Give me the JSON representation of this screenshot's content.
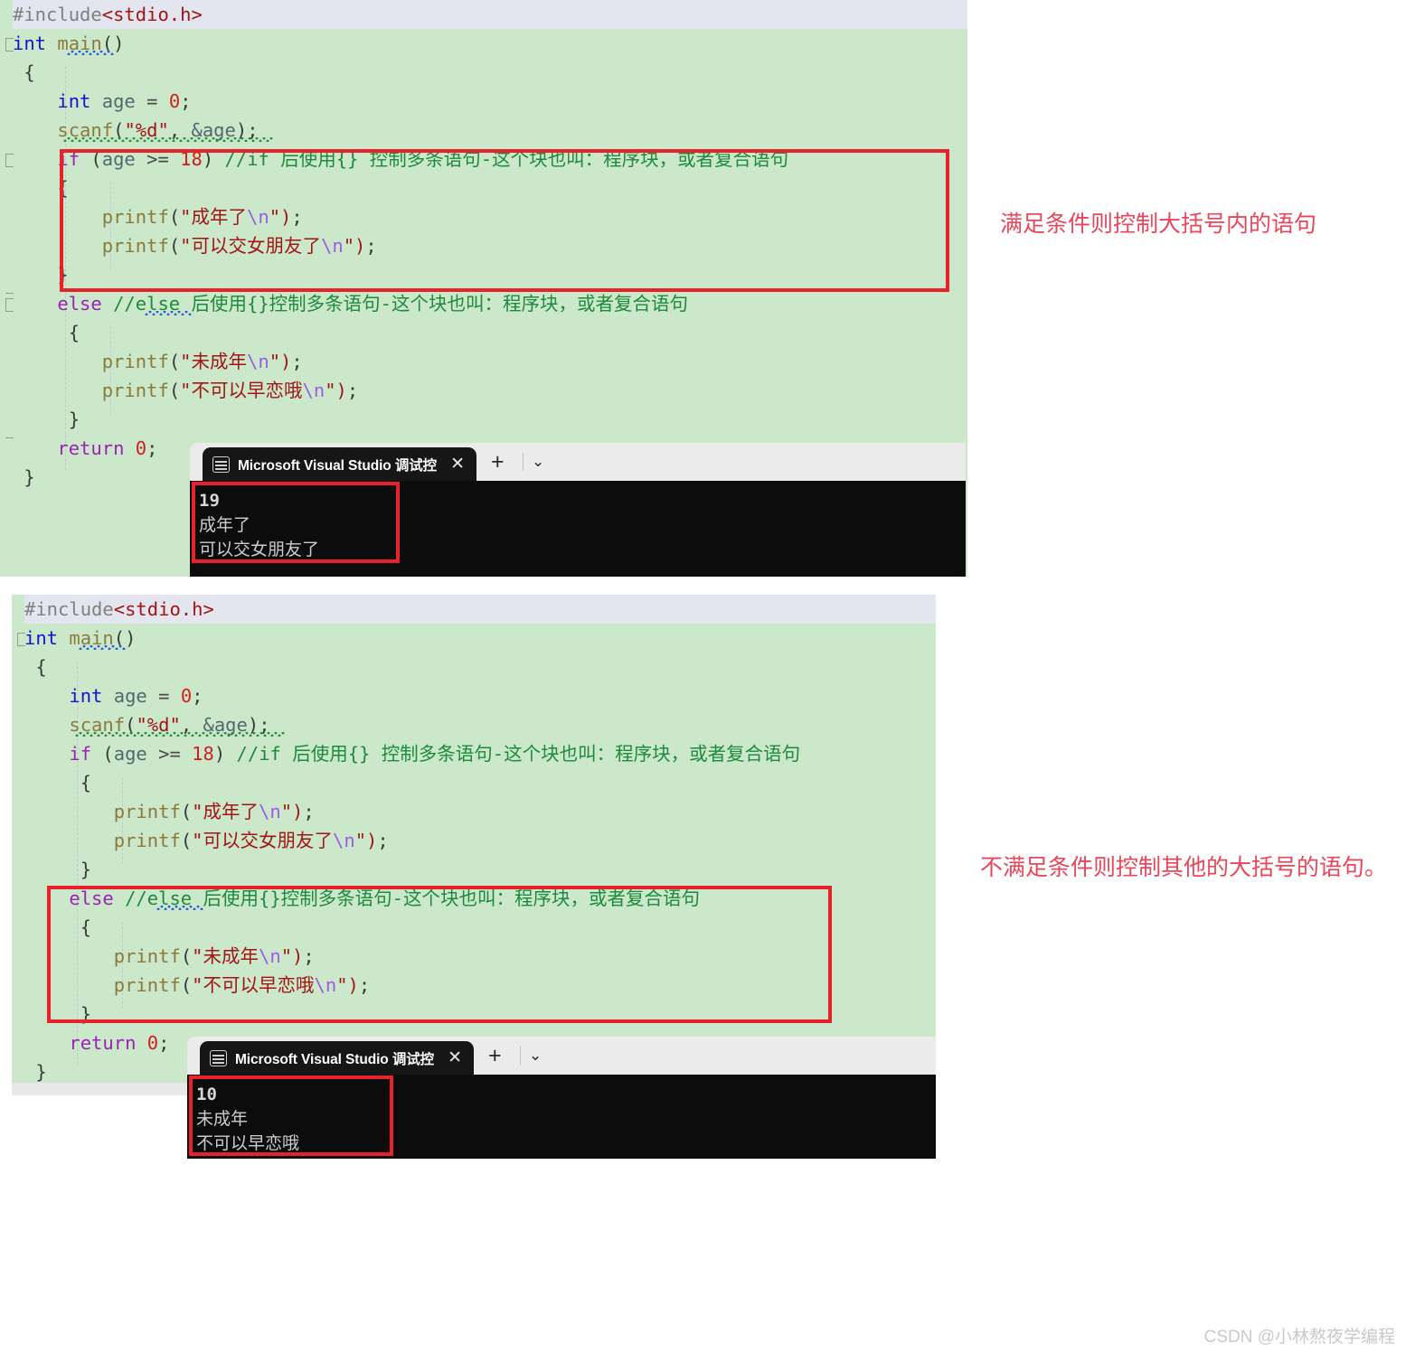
{
  "watermark": "CSDN @小林熬夜学编程",
  "notes": {
    "top": "满足条件则控制大括号内的语句",
    "bottom": "不满足条件则控制其他的大括号的语句。"
  },
  "tokens": {
    "include_pre": "#include",
    "include_hdr": "<stdio.h>",
    "kw_int": "int",
    "fn_main": "main",
    "paren_empty": "()",
    "brace_open": "{",
    "brace_close": "}",
    "id_age": "age",
    "eq": "=",
    "num_zero": "0",
    "semi": ";",
    "fn_scanf": "scanf",
    "str_pct_d": "\"%d\"",
    "amp_age": "&age",
    "ctl_if": "if",
    "ctl_else": "else",
    "ctl_return": "return",
    "op_ge": ">=",
    "num_18": "18",
    "fn_printf": "printf",
    "esc_n": "\\n",
    "str_adult": "\"成年了",
    "str_girlfriend": "\"可以交女朋友了",
    "str_minor": "\"未成年",
    "str_noluv": "\"不可以早恋哦",
    "quote_close": "\")",
    "cmt_if": "//if 后使用{} 控制多条语句-这个块也叫：程序块，或者复合语句",
    "cmt_else": "//else 后使用{}控制多条语句-这个块也叫：程序块，或者复合语句"
  },
  "editor1": {
    "name": "code-editor-if-branch-highlighted",
    "lines": [
      "#include<stdio.h>",
      "int main()",
      "{",
      "    int age = 0;",
      "    scanf(\"%d\", &age);",
      "    if (age >= 18) //if 后使用{} 控制多条语句-这个块也叫：程序块，或者复合语句",
      "    {",
      "        printf(\"成年了\\n\");",
      "        printf(\"可以交女朋友了\\n\");",
      "    }",
      "    else //else 后使用{}控制多条语句-这个块也叫：程序块，或者复合语句",
      "    {",
      "        printf(\"未成年\\n\");",
      "        printf(\"不可以早恋哦\\n\");",
      "    }",
      "    return 0;",
      "}"
    ]
  },
  "editor2": {
    "name": "code-editor-else-branch-highlighted",
    "lines": [
      "#include<stdio.h>",
      "int main()",
      "{",
      "    int age = 0;",
      "    scanf(\"%d\", &age);",
      "    if (age >= 18) //if 后使用{} 控制多条语句-这个块也叫：程序块，或者复合语句",
      "    {",
      "        printf(\"成年了\\n\");",
      "        printf(\"可以交女朋友了\\n\");",
      "    }",
      "    else //else 后使用{}控制多条语句-这个块也叫：程序块，或者复合语句",
      "    {",
      "        printf(\"未成年\\n\");",
      "        printf(\"不可以早恋哦\\n\");",
      "    }",
      "    return 0;",
      "}"
    ]
  },
  "terminal1": {
    "tab_title": "Microsoft Visual Studio 调试控",
    "close_label": "✕",
    "new_tab_label": "+",
    "dropdown_label": "⌄",
    "output": [
      "19",
      "成年了",
      "可以交女朋友了"
    ]
  },
  "terminal2": {
    "tab_title": "Microsoft Visual Studio 调试控",
    "close_label": "✕",
    "new_tab_label": "+",
    "dropdown_label": "⌄",
    "output": [
      "10",
      "未成年",
      "不可以早恋哦"
    ]
  },
  "colors": {
    "editor_bg": "#cbe8ca",
    "highlight_line": "#e4e6ef",
    "redbox": "#e8222a",
    "note_red": "#e8465a",
    "terminal_bg": "#0c0c0c",
    "tabbar_bg": "#ebebeb",
    "keyword_blue": "#1414cf",
    "control_purple": "#9b22b5",
    "string_red": "#a31515",
    "comment_green": "#1e8a3c",
    "number_red": "#cf2020",
    "function_olive": "#8a7a3c"
  }
}
